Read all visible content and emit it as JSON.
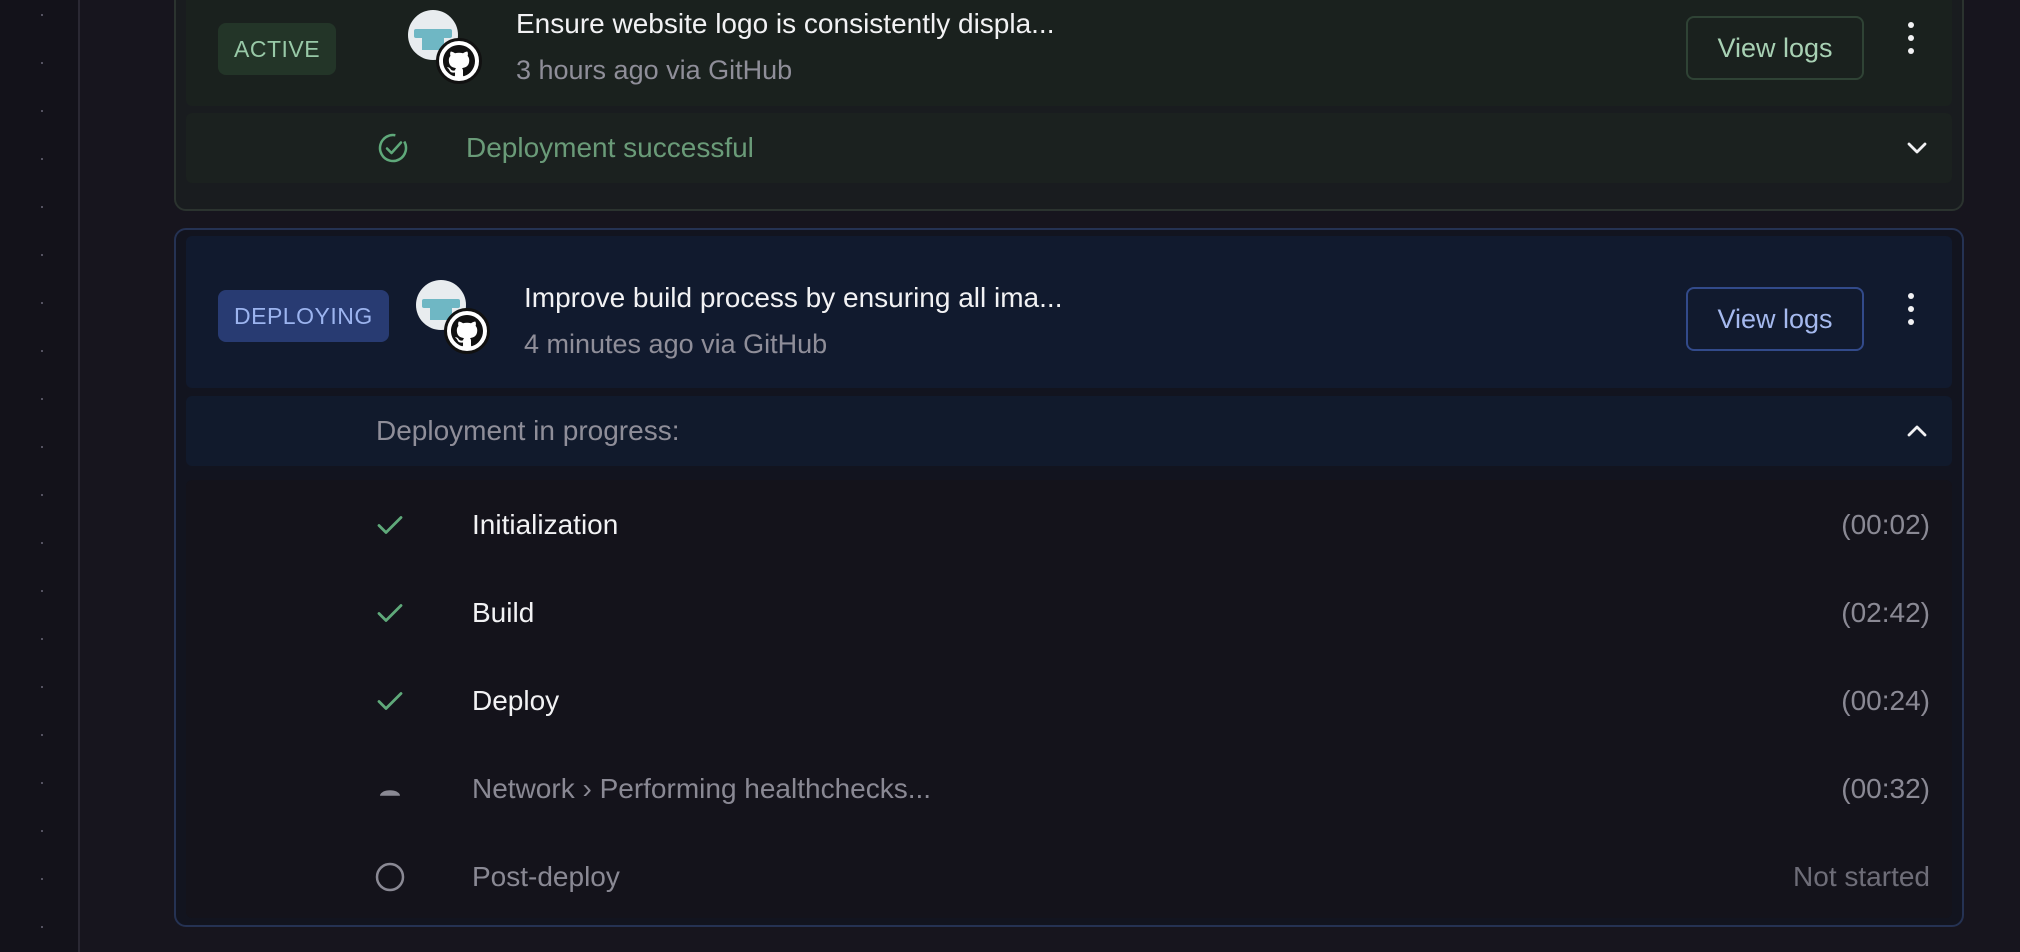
{
  "deployments": [
    {
      "badge": "ACTIVE",
      "title": "Ensure website logo is consistently displa...",
      "meta": "3 hours ago via GitHub",
      "logs_label": "View logs",
      "status_text": "Deployment successful",
      "expanded": false
    },
    {
      "badge": "DEPLOYING",
      "title": "Improve build process by ensuring all ima...",
      "meta": "4 minutes ago via GitHub",
      "logs_label": "View logs",
      "status_text": "Deployment in progress:",
      "expanded": true,
      "steps": [
        {
          "label": "Initialization",
          "time": "(00:02)",
          "state": "done"
        },
        {
          "label": "Build",
          "time": "(02:42)",
          "state": "done"
        },
        {
          "label": "Deploy",
          "time": "(00:24)",
          "state": "done"
        },
        {
          "label": "Network › Performing healthchecks...",
          "time": "(00:32)",
          "state": "running"
        },
        {
          "label": "Post-deploy",
          "time": "Not started",
          "state": "pending"
        }
      ]
    }
  ],
  "colors": {
    "active_accent": "#98c9a7",
    "deploying_accent": "#9cb4ef",
    "check_green": "#5fa97a"
  },
  "icons": {
    "repo_avatar": "service-avatar-icon",
    "source": "github-icon",
    "success": "check-circle-icon",
    "step_done": "check-icon",
    "step_running": "spinner-icon",
    "step_pending": "circle-icon",
    "collapse": "chevron-up-icon",
    "expand": "chevron-down-icon",
    "menu": "kebab-menu-icon"
  }
}
